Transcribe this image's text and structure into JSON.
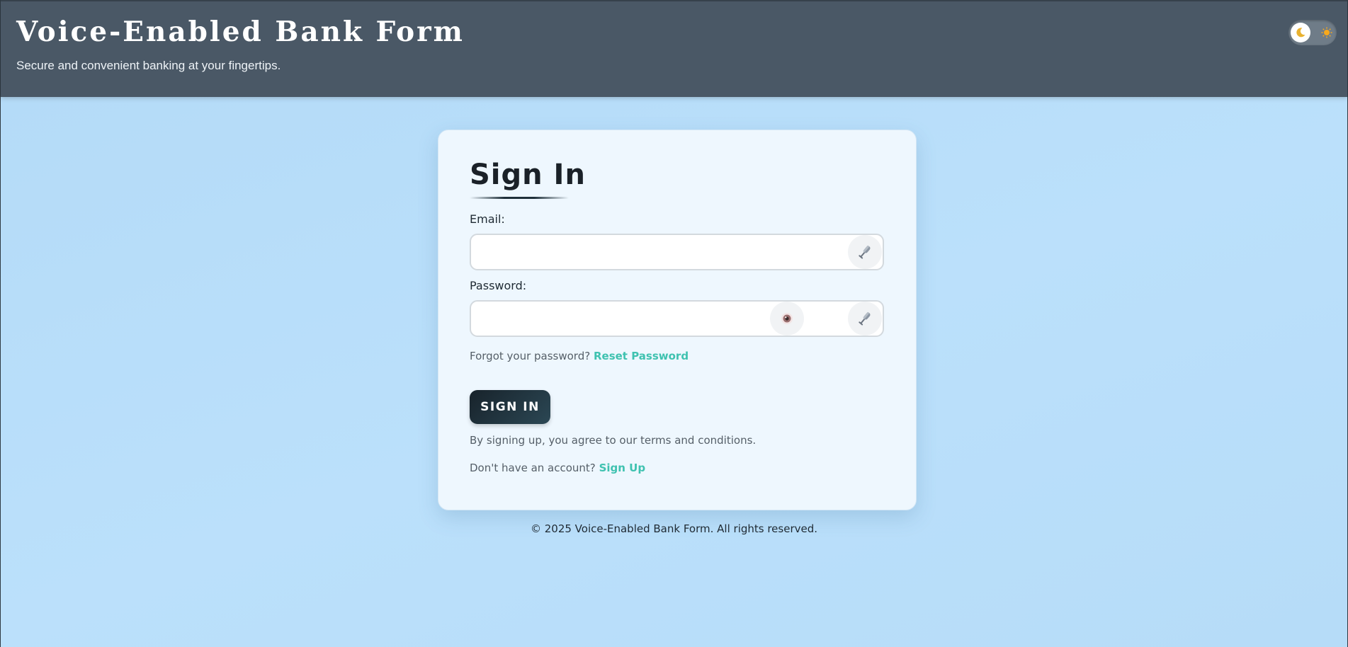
{
  "header": {
    "title": "Voice-Enabled Bank Form",
    "subtitle": "Secure and convenient banking at your fingertips.",
    "theme_toggle": {
      "knob_icon": "moon-icon",
      "other_icon": "sun-icon",
      "state": "light"
    }
  },
  "form": {
    "title": "Sign In",
    "email": {
      "label": "Email:",
      "value": "",
      "placeholder": ""
    },
    "password": {
      "label": "Password:",
      "value": "",
      "placeholder": ""
    },
    "forgot_text": "Forgot your password?",
    "reset_link": "Reset Password",
    "submit_label": "SIGN IN",
    "terms": "By signing up, you agree to our terms and conditions.",
    "no_account_text": "Don't have an account?",
    "signup_link": "Sign Up"
  },
  "footer": {
    "text": "© 2025 Voice-Enabled Bank Form. All rights reserved."
  },
  "colors": {
    "header_bg": "#4a5866",
    "page_bg": "#b8defa",
    "card_bg": "#eef7fe",
    "link": "#3fc2b0",
    "button_dark": "#1f303a"
  }
}
